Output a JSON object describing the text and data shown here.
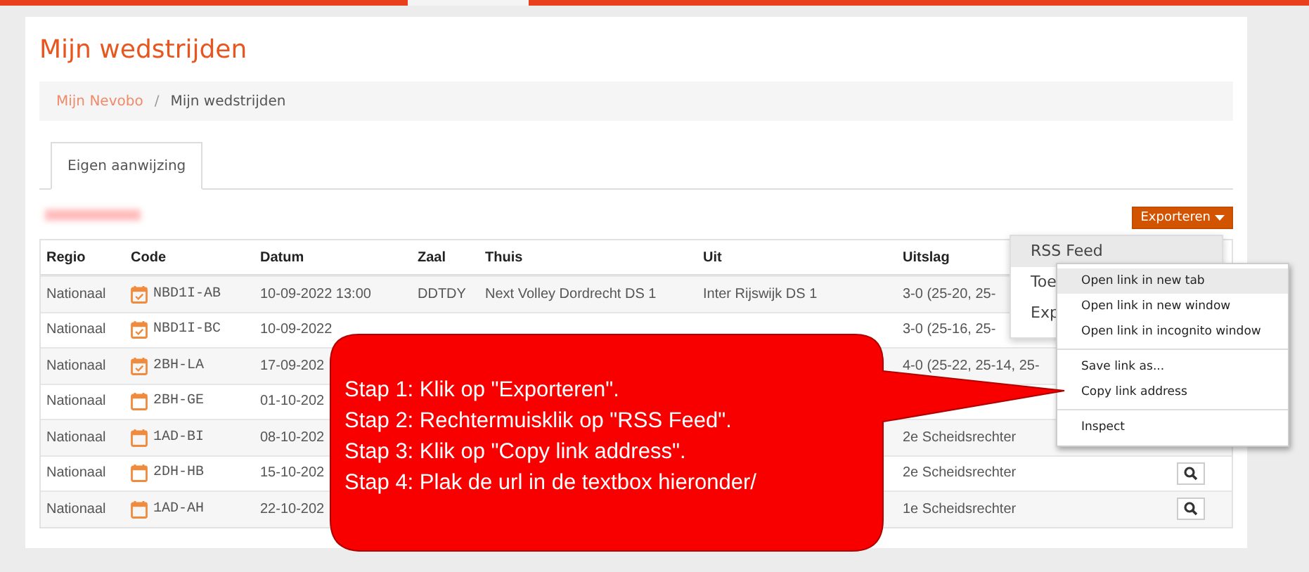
{
  "page_title": "Mijn wedstrijden",
  "breadcrumb_separator": "/",
  "breadcrumb": [
    {
      "label": "Mijn Nevobo",
      "kind": "link"
    },
    {
      "label": "Mijn wedstrijden",
      "kind": "current"
    }
  ],
  "tabs": [
    {
      "label": "Eigen aanwijzing",
      "selected": true
    }
  ],
  "export_button": {
    "label": "Exporteren"
  },
  "table": {
    "columns": [
      "Regio",
      "Code",
      "Datum",
      "Zaal",
      "Thuis",
      "Uit",
      "Uitslag"
    ],
    "rows": [
      {
        "regio": "Nationaal",
        "code": "NBD1I-AB",
        "confirmed": true,
        "datum": "10-09-2022 13:00",
        "zaal": "DDTDY",
        "thuis": "Next Volley Dordrecht DS 1",
        "uit": "Inter Rijswijk DS 1",
        "uitslag": "3-0 (25-20, 25-",
        "search": false
      },
      {
        "regio": "Nationaal",
        "code": "NBD1I-BC",
        "confirmed": true,
        "datum": "10-09-2022",
        "uitslag": "3-0 (25-16, 25-",
        "search": false
      },
      {
        "regio": "Nationaal",
        "code": "2BH-LA",
        "confirmed": true,
        "datum": "17-09-202",
        "uitslag": "4-0 (25-22, 25-14, 25-",
        "search": false
      },
      {
        "regio": "Nationaal",
        "code": "2BH-GE",
        "confirmed": false,
        "datum": "01-10-202",
        "search": false
      },
      {
        "regio": "Nationaal",
        "code": "1AD-BI",
        "confirmed": false,
        "datum": "08-10-202",
        "uitslag": "2e Scheidsrechter",
        "search": false
      },
      {
        "regio": "Nationaal",
        "code": "2DH-HB",
        "confirmed": false,
        "datum": "15-10-202",
        "uitslag": "2e Scheidsrechter",
        "search": true
      },
      {
        "regio": "Nationaal",
        "code": "1AD-AH",
        "confirmed": false,
        "datum": "22-10-202",
        "uitslag": "1e Scheidsrechter",
        "search": true
      }
    ]
  },
  "export_menu": [
    {
      "label": "RSS Feed",
      "selected": true
    },
    {
      "label": "Toe",
      "selected": false
    },
    {
      "label": "Exp",
      "selected": false
    }
  ],
  "context_menu": [
    {
      "label": "Open link in new tab",
      "selected": true,
      "separator_before": false
    },
    {
      "label": "Open link in new window",
      "selected": false,
      "separator_before": false
    },
    {
      "label": "Open link in incognito window",
      "selected": false,
      "separator_before": false
    },
    {
      "label": "Save link as...",
      "selected": false,
      "separator_before": true
    },
    {
      "label": "Copy link address",
      "selected": false,
      "separator_before": false
    },
    {
      "label": "Inspect",
      "selected": false,
      "separator_before": true
    }
  ],
  "callout": [
    "Stap 1: Klik op \"Exporteren\".",
    "Stap 2: Rechtermuisklik op \"RSS Feed\".",
    "Stap 3: Klik op \"Copy link address\".",
    "Stap 4: Plak de url in de textbox hieronder/"
  ]
}
